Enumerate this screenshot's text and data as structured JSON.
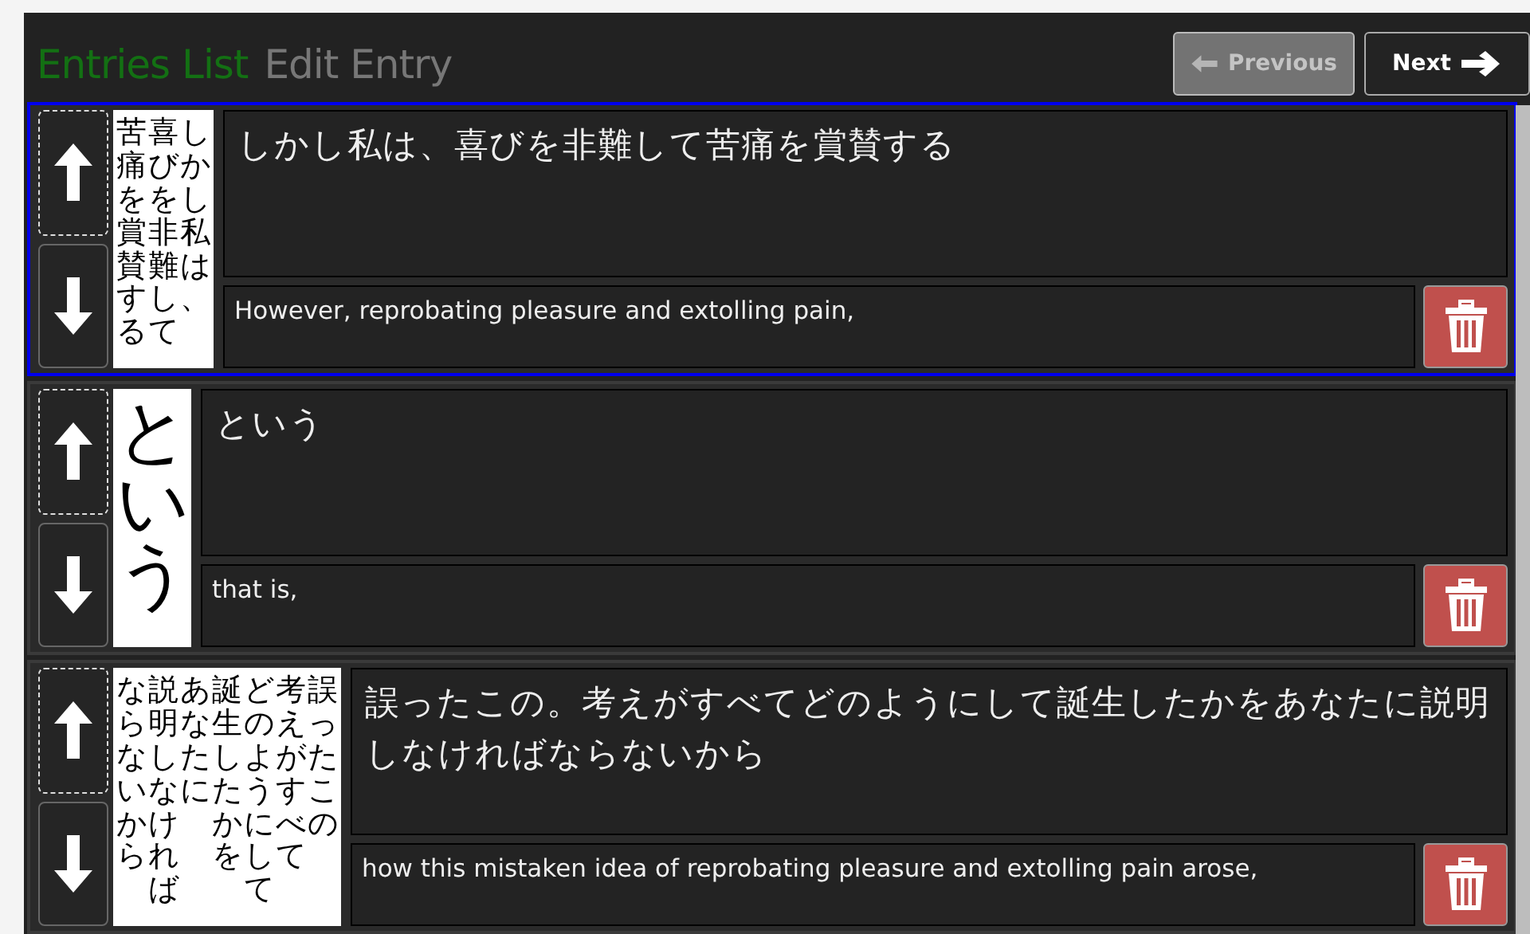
{
  "tabs": [
    {
      "label": "Entries List",
      "selected": true
    },
    {
      "label": "Edit Entry",
      "selected": false
    }
  ],
  "nav_buttons": [
    {
      "kind": "previous",
      "label": "Previous",
      "disabled": true
    },
    {
      "kind": "next",
      "label": "Next",
      "disabled": false
    }
  ],
  "entries": [
    {
      "selected": true,
      "thumbnail_columns": [
        "苦痛を賞賛する",
        "喜びを非難して",
        "しかし私は、"
      ],
      "source_text": "しかし私は、喜びを非難して苦痛を賞賛する",
      "translation": "However, reprobating pleasure and extolling pain,"
    },
    {
      "selected": false,
      "thumbnail_columns": [
        "という"
      ],
      "source_text": "という",
      "translation": "that is,"
    },
    {
      "selected": false,
      "thumbnail_columns": [
        "ならないから",
        "説明しなければ",
        "あなたに",
        "誕生したかを",
        "どのようにして",
        "考えがすべて",
        "誤ったこの"
      ],
      "source_text": "誤ったこの。考えがすべてどのようにして誕生したかをあなたに説明しなければならないから",
      "translation": "how this mistaken idea of reprobating pleasure and extolling pain arose,"
    }
  ]
}
